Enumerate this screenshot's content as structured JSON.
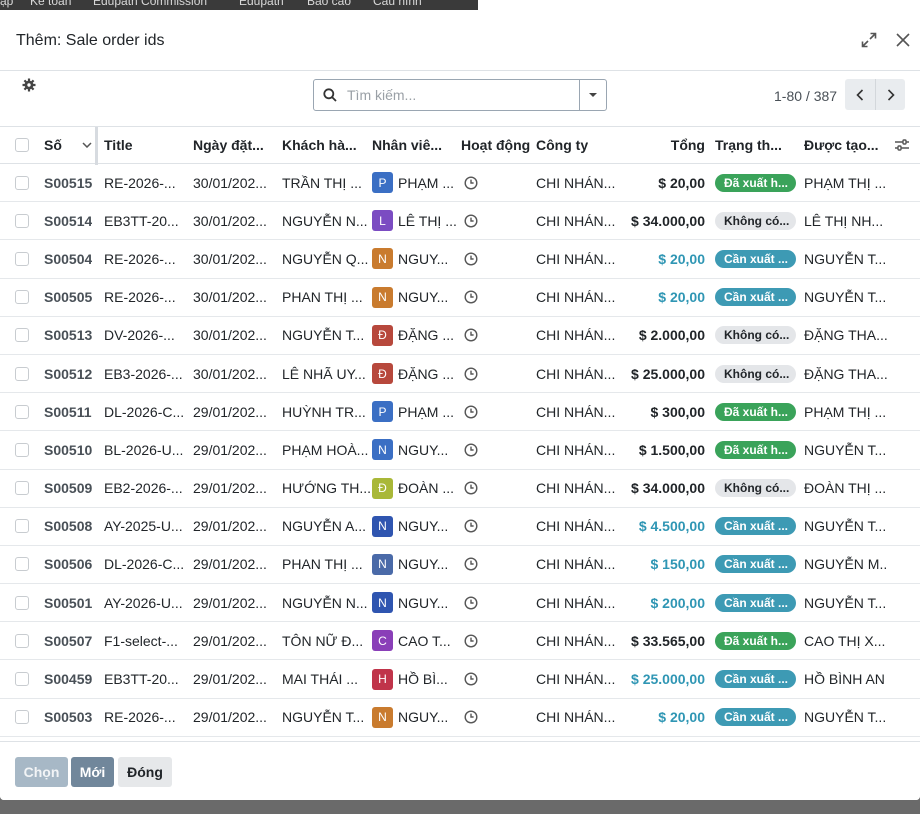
{
  "topbar": {
    "menu": [
      "ập",
      "Kế toán",
      "Edupath Commission",
      "Edupath",
      "Báo cáo",
      "Cấu hình"
    ]
  },
  "dialog": {
    "title": "Thêm: Sale order ids"
  },
  "search": {
    "placeholder": "Tìm kiếm..."
  },
  "pager": {
    "text": "1-80 / 387"
  },
  "columns": {
    "number": "Số",
    "title": "Title",
    "date": "Ngày đặt...",
    "customer": "Khách hà...",
    "salesperson": "Nhân viê...",
    "activity": "Hoạt động",
    "company": "Công ty",
    "total": "Tổng",
    "status": "Trạng th...",
    "created_by": "Được tạo..."
  },
  "rows": [
    {
      "number": "S00515",
      "title": "RE-2026-...",
      "date": "30/01/202...",
      "customer": "TRẦN THỊ ...",
      "av_letter": "P",
      "av_color": "#3b6fc4",
      "salesperson": "PHẠM ...",
      "company": "CHI NHÁN...",
      "total": "$ 20,00",
      "total_color": "#212529",
      "status": "Đã xuất h...",
      "status_bg": "#3aa35a",
      "status_fg": "#ffffff",
      "created_by": "PHẠM THỊ ..."
    },
    {
      "number": "S00514",
      "title": "EB3TT-20...",
      "date": "30/01/202...",
      "customer": "NGUYỄN N...",
      "av_letter": "L",
      "av_color": "#7b4cc2",
      "salesperson": "LÊ THỊ ...",
      "company": "CHI NHÁN...",
      "total": "$ 34.000,00",
      "total_color": "#212529",
      "status": "Không có...",
      "status_bg": "#e4e6e9",
      "status_fg": "#212529",
      "created_by": "LÊ THỊ NH..."
    },
    {
      "number": "S00504",
      "title": "RE-2026-...",
      "date": "30/01/202...",
      "customer": "NGUYỄN Q...",
      "av_letter": "N",
      "av_color": "#c97b2e",
      "salesperson": "NGUY...",
      "company": "CHI NHÁN...",
      "total": "$ 20,00",
      "total_color": "#2f96b4",
      "status": "Cần xuất ...",
      "status_bg": "#3d9ab4",
      "status_fg": "#ffffff",
      "created_by": "NGUYỄN T..."
    },
    {
      "number": "S00505",
      "title": "RE-2026-...",
      "date": "30/01/202...",
      "customer": "PHAN THỊ ...",
      "av_letter": "N",
      "av_color": "#c97b2e",
      "salesperson": "NGUY...",
      "company": "CHI NHÁN...",
      "total": "$ 20,00",
      "total_color": "#2f96b4",
      "status": "Cần xuất ...",
      "status_bg": "#3d9ab4",
      "status_fg": "#ffffff",
      "created_by": "NGUYỄN T..."
    },
    {
      "number": "S00513",
      "title": "DV-2026-...",
      "date": "30/01/202...",
      "customer": "NGUYỄN T...",
      "av_letter": "Đ",
      "av_color": "#b7483c",
      "salesperson": "ĐẶNG ...",
      "company": "CHI NHÁN...",
      "total": "$ 2.000,00",
      "total_color": "#212529",
      "status": "Không có...",
      "status_bg": "#e4e6e9",
      "status_fg": "#212529",
      "created_by": "ĐẶNG THA..."
    },
    {
      "number": "S00512",
      "title": "EB3-2026-...",
      "date": "30/01/202...",
      "customer": "LÊ NHÃ UY...",
      "av_letter": "Đ",
      "av_color": "#b7483c",
      "salesperson": "ĐẶNG ...",
      "company": "CHI NHÁN...",
      "total": "$ 25.000,00",
      "total_color": "#212529",
      "status": "Không có...",
      "status_bg": "#e4e6e9",
      "status_fg": "#212529",
      "created_by": "ĐẶNG THA..."
    },
    {
      "number": "S00511",
      "title": "DL-2026-C...",
      "date": "29/01/202...",
      "customer": "HUỲNH TR...",
      "av_letter": "P",
      "av_color": "#3b6fc4",
      "salesperson": "PHẠM ...",
      "company": "CHI NHÁN...",
      "total": "$ 300,00",
      "total_color": "#212529",
      "status": "Đã xuất h...",
      "status_bg": "#3aa35a",
      "status_fg": "#ffffff",
      "created_by": "PHẠM THỊ ..."
    },
    {
      "number": "S00510",
      "title": "BL-2026-U...",
      "date": "29/01/202...",
      "customer": "PHẠM HOÀ...",
      "av_letter": "N",
      "av_color": "#3b6fc4",
      "salesperson": "NGUY...",
      "company": "CHI NHÁN...",
      "total": "$ 1.500,00",
      "total_color": "#212529",
      "status": "Đã xuất h...",
      "status_bg": "#3aa35a",
      "status_fg": "#ffffff",
      "created_by": "NGUYỄN T..."
    },
    {
      "number": "S00509",
      "title": "EB2-2026-...",
      "date": "29/01/202...",
      "customer": "HƯỚNG TH...",
      "av_letter": "Đ",
      "av_color": "#a9b838",
      "salesperson": "ĐOÀN ...",
      "company": "CHI NHÁN...",
      "total": "$ 34.000,00",
      "total_color": "#212529",
      "status": "Không có...",
      "status_bg": "#e4e6e9",
      "status_fg": "#212529",
      "created_by": "ĐOÀN THỊ ..."
    },
    {
      "number": "S00508",
      "title": "AY-2025-U...",
      "date": "29/01/202...",
      "customer": "NGUYỄN A...",
      "av_letter": "N",
      "av_color": "#2f55b0",
      "salesperson": "NGUY...",
      "company": "CHI NHÁN...",
      "total": "$ 4.500,00",
      "total_color": "#2f96b4",
      "status": "Cần xuất ...",
      "status_bg": "#3d9ab4",
      "status_fg": "#ffffff",
      "created_by": "NGUYỄN T..."
    },
    {
      "number": "S00506",
      "title": "DL-2026-C...",
      "date": "29/01/202...",
      "customer": "PHAN THỊ ...",
      "av_letter": "N",
      "av_color": "#4a6aa8",
      "salesperson": "NGUY...",
      "company": "CHI NHÁN...",
      "total": "$ 150,00",
      "total_color": "#2f96b4",
      "status": "Cần xuất ...",
      "status_bg": "#3d9ab4",
      "status_fg": "#ffffff",
      "created_by": "NGUYỄN M..."
    },
    {
      "number": "S00501",
      "title": "AY-2026-U...",
      "date": "29/01/202...",
      "customer": "NGUYỄN N...",
      "av_letter": "N",
      "av_color": "#2f55b0",
      "salesperson": "NGUY...",
      "company": "CHI NHÁN...",
      "total": "$ 200,00",
      "total_color": "#2f96b4",
      "status": "Cần xuất ...",
      "status_bg": "#3d9ab4",
      "status_fg": "#ffffff",
      "created_by": "NGUYỄN T..."
    },
    {
      "number": "S00507",
      "title": "F1-select-...",
      "date": "29/01/202...",
      "customer": "TÔN NỮ Đ...",
      "av_letter": "C",
      "av_color": "#8a3fb8",
      "salesperson": "CAO T...",
      "company": "CHI NHÁN...",
      "total": "$ 33.565,00",
      "total_color": "#212529",
      "status": "Đã xuất h...",
      "status_bg": "#3aa35a",
      "status_fg": "#ffffff",
      "created_by": "CAO THỊ X..."
    },
    {
      "number": "S00459",
      "title": "EB3TT-20...",
      "date": "29/01/202...",
      "customer": "MAI THÁI ...",
      "av_letter": "H",
      "av_color": "#c0344a",
      "salesperson": "HỒ BÌ...",
      "company": "CHI NHÁN...",
      "total": "$ 25.000,00",
      "total_color": "#2f96b4",
      "status": "Cần xuất ...",
      "status_bg": "#3d9ab4",
      "status_fg": "#ffffff",
      "created_by": "HỒ BÌNH AN"
    },
    {
      "number": "S00503",
      "title": "RE-2026-...",
      "date": "29/01/202...",
      "customer": "NGUYỄN T...",
      "av_letter": "N",
      "av_color": "#c97b2e",
      "salesperson": "NGUY...",
      "company": "CHI NHÁN...",
      "total": "$ 20,00",
      "total_color": "#2f96b4",
      "status": "Cần xuất ...",
      "status_bg": "#3d9ab4",
      "status_fg": "#ffffff",
      "created_by": "NGUYỄN T..."
    }
  ],
  "footer": {
    "select": "Chọn",
    "new": "Mới",
    "close": "Đóng"
  },
  "colors": {
    "primary": "#71879b",
    "primary_disabled": "#a7b8c6",
    "secondary": "#e6e8ea",
    "accent": "#2f96b4"
  }
}
